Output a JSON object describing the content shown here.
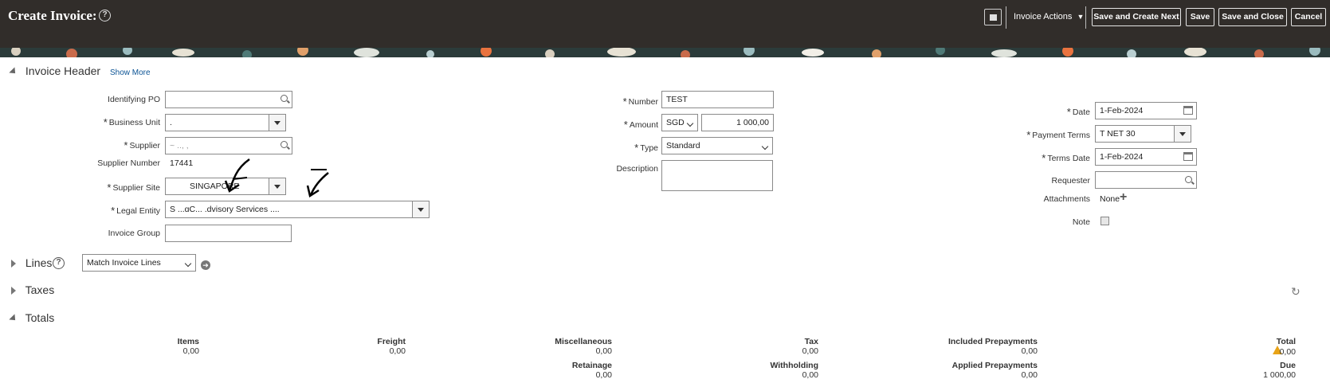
{
  "header": {
    "title": "Create Invoice:",
    "help_icon": "question-circle-icon",
    "invoice_actions_label": "Invoice Actions",
    "buttons": {
      "save_and_create_next": "Save and Create Next",
      "save": "Save",
      "save_and_close": "Save and Close",
      "cancel": "Cancel"
    }
  },
  "invoice_header": {
    "title": "Invoice Header",
    "show_more": "Show More",
    "left": {
      "identifying_po": {
        "label": "Identifying PO",
        "value": ""
      },
      "business_unit": {
        "label": "Business Unit",
        "value": "."
      },
      "supplier": {
        "label": "Supplier",
        "value": "~          ..,          ,"
      },
      "supplier_number": {
        "label": "Supplier Number",
        "value": "17441"
      },
      "supplier_site": {
        "label": "Supplier Site",
        "value": "SINGAPORE"
      },
      "legal_entity": {
        "label": "Legal Entity",
        "value": "S                      ...ɑC...          .dvisory Services          ...."
      },
      "invoice_group": {
        "label": "Invoice Group",
        "value": ""
      }
    },
    "middle": {
      "number": {
        "label": "Number",
        "value": "TEST"
      },
      "amount": {
        "label": "Amount",
        "currency": "SGD",
        "value": "1 000,00"
      },
      "type": {
        "label": "Type",
        "value": "Standard"
      },
      "description": {
        "label": "Description",
        "value": ""
      }
    },
    "right": {
      "date": {
        "label": "Date",
        "value": "1-Feb-2024"
      },
      "payment_terms": {
        "label": "Payment Terms",
        "value": "T       NET 30"
      },
      "terms_date": {
        "label": "Terms Date",
        "value": "1-Feb-2024"
      },
      "requester": {
        "label": "Requester",
        "value": ""
      },
      "attachments": {
        "label": "Attachments",
        "value": "None"
      },
      "note": {
        "label": "Note"
      }
    }
  },
  "lines": {
    "title": "Lines",
    "match_select": "Match Invoice Lines"
  },
  "taxes": {
    "title": "Taxes"
  },
  "totals": {
    "title": "Totals",
    "items": {
      "label": "Items",
      "value": "0,00"
    },
    "freight": {
      "label": "Freight",
      "value": "0,00"
    },
    "miscellaneous": {
      "label": "Miscellaneous",
      "value": "0,00"
    },
    "tax": {
      "label": "Tax",
      "value": "0,00"
    },
    "included_prepayments": {
      "label": "Included Prepayments",
      "value": "0,00"
    },
    "total": {
      "label": "Total",
      "value": "0,00"
    },
    "retainage": {
      "label": "Retainage",
      "value": "0,00"
    },
    "withholding": {
      "label": "Withholding",
      "value": "0,00"
    },
    "applied_prepayments": {
      "label": "Applied Prepayments",
      "value": "0,00"
    },
    "due": {
      "label": "Due",
      "value": "1 000,00"
    }
  },
  "colors": {
    "topbar": "#312d2a",
    "link": "#0b5394",
    "warning": "#e8a317"
  }
}
